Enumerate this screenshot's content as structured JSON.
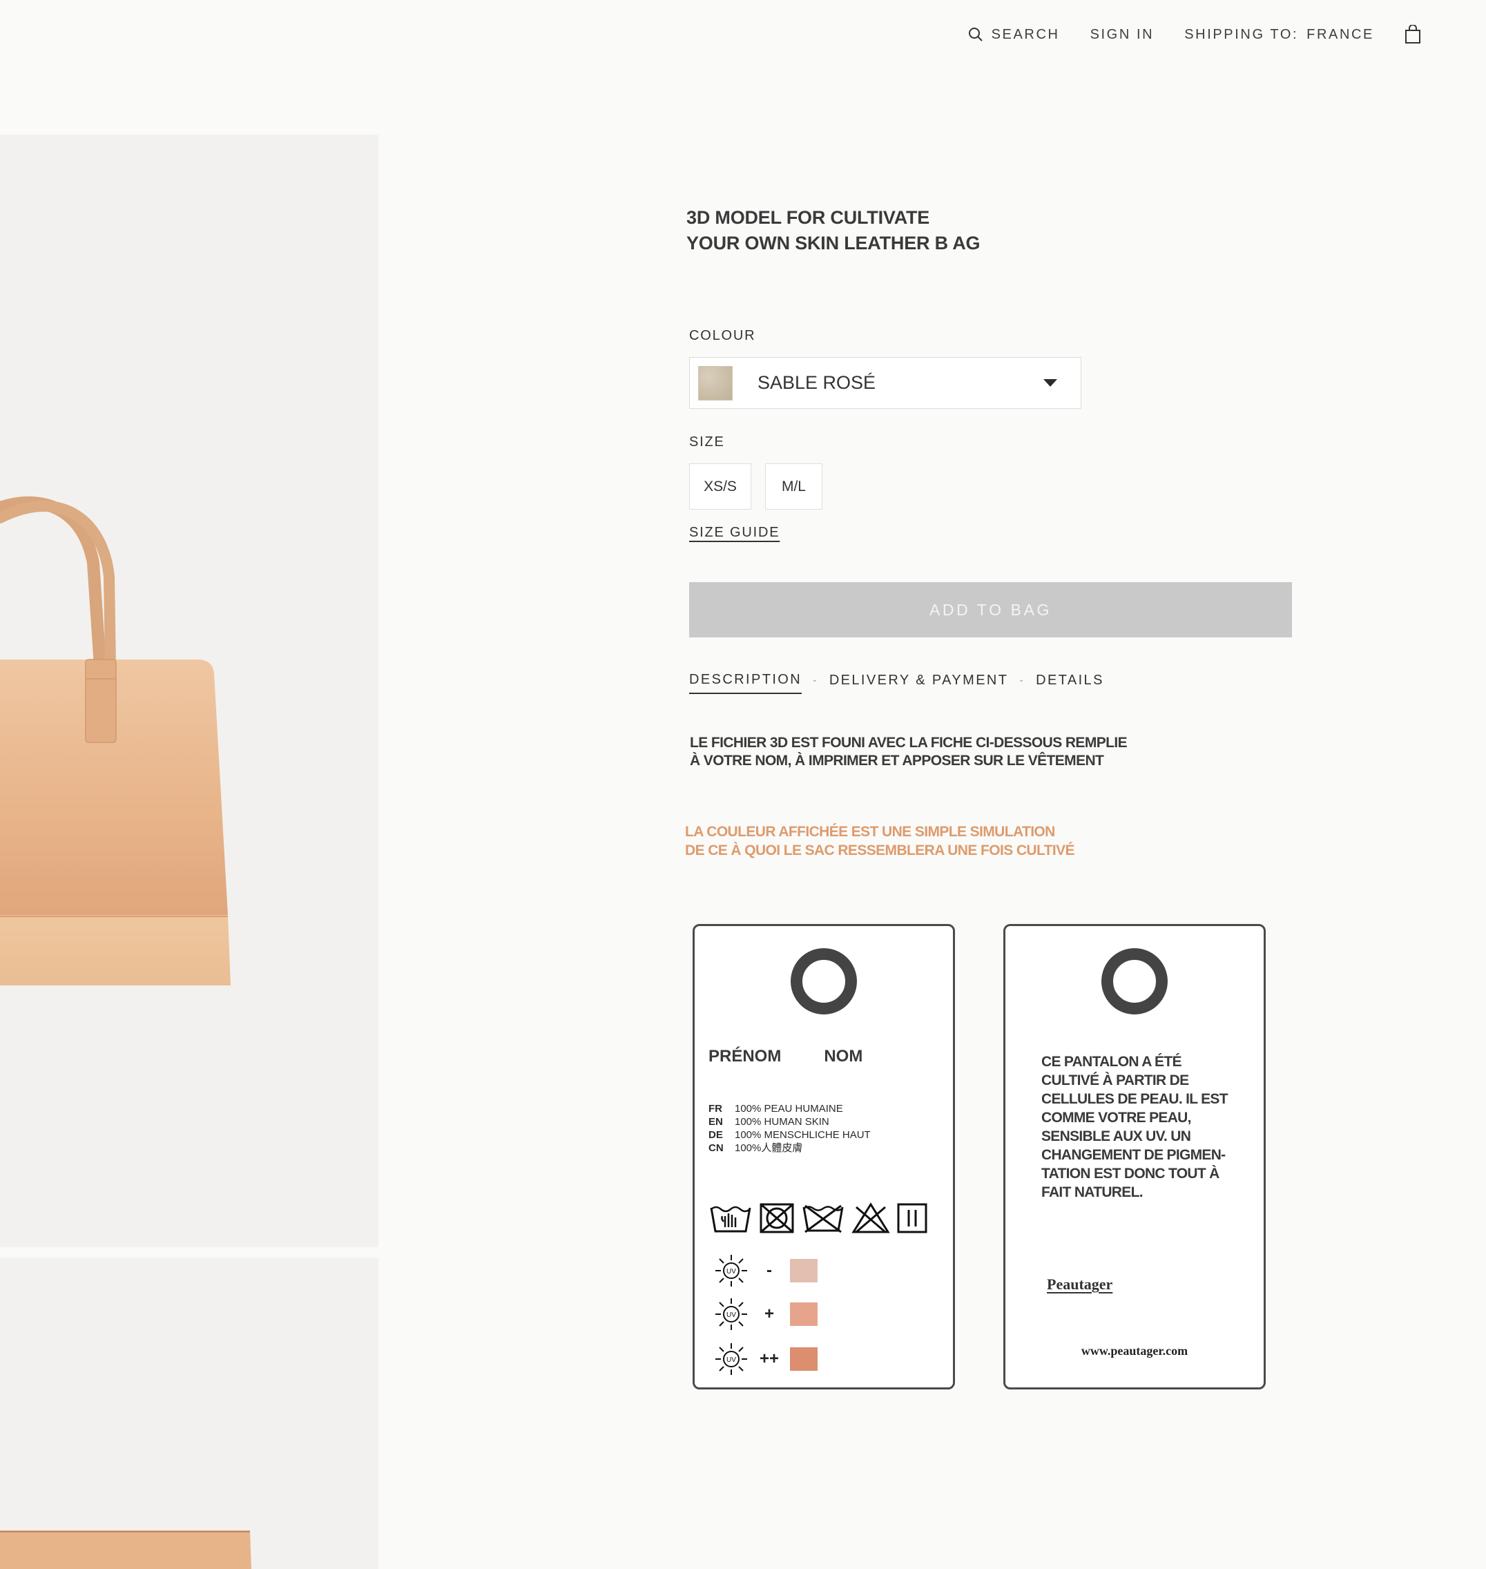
{
  "header": {
    "search_label": "SEARCH",
    "sign_in_label": "SIGN IN",
    "shipping_label": "SHIPPING TO:",
    "shipping_value": "FRANCE",
    "icons": [
      "search-icon",
      "bag-icon"
    ]
  },
  "product": {
    "title_line1": "3D MODEL FOR CULTIVATE",
    "title_line2": "YOUR OWN SKIN LEATHER B AG",
    "colour_label": "COLOUR",
    "colour_value": "SABLE ROSÉ",
    "size_label": "SIZE",
    "sizes": [
      "XS/S",
      "M/L"
    ],
    "size_guide_label": "SIZE GUIDE",
    "add_to_bag_label": "ADD TO BAG"
  },
  "tabs": {
    "items": [
      "DESCRIPTION",
      "DELIVERY & PAYMENT",
      "DETAILS"
    ],
    "separator": "-",
    "active": "DESCRIPTION"
  },
  "description": {
    "line1": "LE FICHIER 3D EST FOUNI AVEC LA FICHE CI-DESSOUS REMPLIE",
    "line2": "À VOTRE NOM, À IMPRIMER ET APPOSER SUR LE VÊTEMENT"
  },
  "notice": {
    "line1": "LA COULEUR AFFICHÉE EST UNE SIMPLE SIMULATION",
    "line2": "DE CE À QUOI LE SAC RESSEMBLERA UNE FOIS CULTIVÉ"
  },
  "tag_front": {
    "first_name_label": "PRÉNOM",
    "last_name_label": "NOM",
    "composition": [
      {
        "code": "FR",
        "text": "100% PEAU HUMAINE"
      },
      {
        "code": "EN",
        "text": "100% HUMAN SKIN"
      },
      {
        "code": "DE",
        "text": "100% MENSCHLICHE HAUT"
      },
      {
        "code": "CN",
        "text": "100%人體皮膚"
      }
    ],
    "uv_label": "UV",
    "uv_levels": [
      {
        "sign": "-",
        "color": "#e3bfb1"
      },
      {
        "sign": "+",
        "color": "#e7a48c"
      },
      {
        "sign": "++",
        "color": "#dc8e6f"
      }
    ]
  },
  "tag_back": {
    "body": [
      "CE PANTALON A ÉTÉ",
      "CULTIVÉ À PARTIR DE",
      "CELLULES DE PEAU. IL EST",
      "COMME VOTRE PEAU,",
      "SENSIBLE AUX UV. UN",
      "CHANGEMENT DE PIGMEN-",
      "TATION EST DONC TOUT À",
      "FAIT NATUREL."
    ],
    "brand": "Peautager",
    "url": "www.peautager.com"
  },
  "colors": {
    "accent_notice": "#dd9b6c",
    "button_disabled": "#c9c9c9",
    "gallery_bg": "#f2f1ef",
    "bag_leather": "#e8b98f"
  }
}
